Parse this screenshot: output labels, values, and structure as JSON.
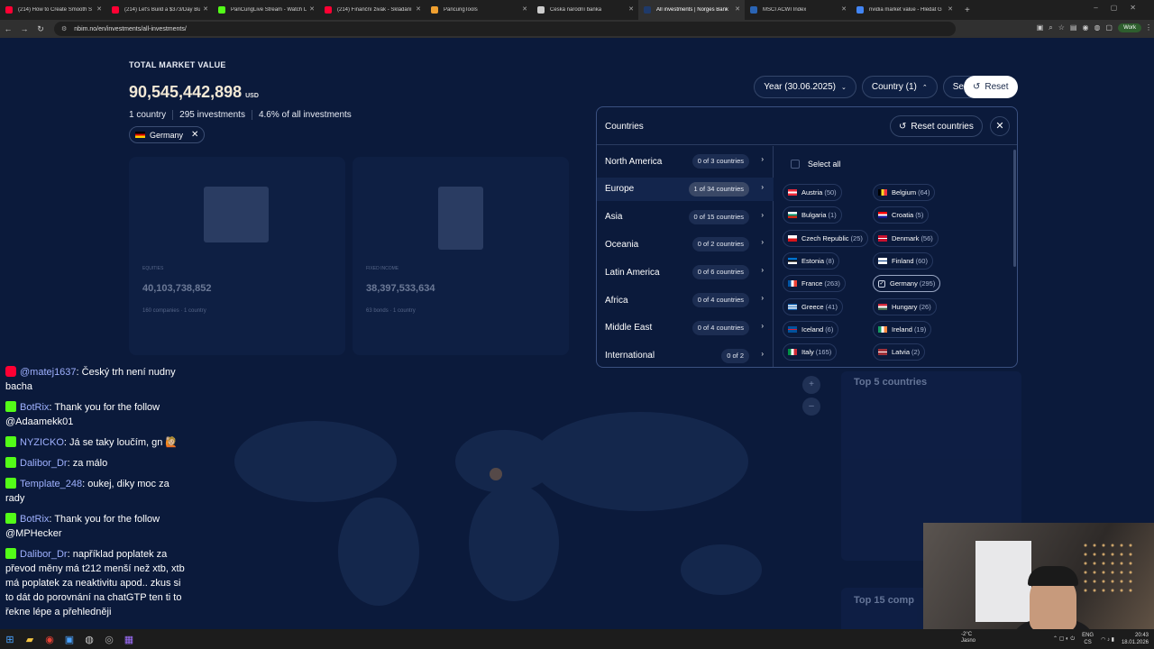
{
  "browser": {
    "tabs": [
      {
        "label": "(214) How to Create Smooth S",
        "icon_color": "#ff0033"
      },
      {
        "label": "(214) Let's Build a $373/Day Bu",
        "icon_color": "#ff0033"
      },
      {
        "label": "PanCungLive Stream - Watch Li",
        "icon_color": "#53fc18"
      },
      {
        "label": "(214) Finanční živák - Skládání",
        "icon_color": "#ff0033"
      },
      {
        "label": "PancungTools",
        "icon_color": "#f0a030"
      },
      {
        "label": "Česká národní banka",
        "icon_color": "#cccccc"
      },
      {
        "label": "All investments | Norges Bank",
        "icon_color": "#1f3a6a"
      },
      {
        "label": "MSCI ACWI Index",
        "icon_color": "#2a64b4"
      },
      {
        "label": "nvidia market value - Hledat G",
        "icon_color": "#4285f4"
      }
    ],
    "url": "nbim.no/en/investments/all-investments/",
    "profile_badge": "Work"
  },
  "summary": {
    "label": "TOTAL MARKET VALUE",
    "value": "90,545,442,898",
    "currency": "USD",
    "countries": "1 country",
    "investments": "295 investments",
    "share": "4.6% of all investments",
    "filter_chip": "Germany"
  },
  "filters": {
    "year": "Year (30.06.2025)",
    "country": "Country (1)",
    "sector": "Sector (all)",
    "reset": "Reset"
  },
  "countries_panel": {
    "title": "Countries",
    "reset": "Reset countries",
    "select_all": "Select all",
    "regions": [
      {
        "name": "North America",
        "count": "0 of 3 countries"
      },
      {
        "name": "Europe",
        "count": "1 of 34 countries",
        "active": true
      },
      {
        "name": "Asia",
        "count": "0 of 15 countries"
      },
      {
        "name": "Oceania",
        "count": "0 of 2 countries"
      },
      {
        "name": "Latin America",
        "count": "0 of 6 countries"
      },
      {
        "name": "Africa",
        "count": "0 of 4 countries"
      },
      {
        "name": "Middle East",
        "count": "0 of 4 countries"
      },
      {
        "name": "International",
        "count": "0 of 2"
      }
    ],
    "countries": [
      {
        "name": "Austria",
        "n": "(50)"
      },
      {
        "name": "Belgium",
        "n": "(64)"
      },
      {
        "name": "Bulgaria",
        "n": "(1)"
      },
      {
        "name": "Croatia",
        "n": "(5)"
      },
      {
        "name": "Czech Republic",
        "n": "(25)"
      },
      {
        "name": "Denmark",
        "n": "(56)"
      },
      {
        "name": "Estonia",
        "n": "(8)"
      },
      {
        "name": "Finland",
        "n": "(60)"
      },
      {
        "name": "France",
        "n": "(263)"
      },
      {
        "name": "Germany",
        "n": "(295)",
        "selected": true
      },
      {
        "name": "Greece",
        "n": "(41)"
      },
      {
        "name": "Hungary",
        "n": "(26)"
      },
      {
        "name": "Iceland",
        "n": "(6)"
      },
      {
        "name": "Ireland",
        "n": "(19)"
      },
      {
        "name": "Italy",
        "n": "(165)"
      },
      {
        "name": "Latvia",
        "n": "(2)"
      }
    ]
  },
  "background": {
    "card1": {
      "label": "EQUITIES",
      "value": "40,103,738,852",
      "sub": "160 companies · 1 country"
    },
    "card2": {
      "label": "FIXED INCOME",
      "value": "38,397,533,634",
      "sub": "63 bonds · 1 country"
    },
    "top5": "Top 5 countries",
    "top15": "Top 15 comp"
  },
  "chat": [
    {
      "platform": "yt",
      "user": "@matej1637",
      "text": "Český trh není nudny bacha"
    },
    {
      "platform": "kick",
      "user": "BotRix",
      "text": "Thank you for the follow @Adaamekk01"
    },
    {
      "platform": "kick",
      "user": "NYZICKO",
      "text": "Já se taky loučím, gn 🙋🏼"
    },
    {
      "platform": "kick",
      "user": "Dalibor_Dr",
      "text": "za málo"
    },
    {
      "platform": "kick",
      "user": "Template_248",
      "text": "oukej, diky moc za rady"
    },
    {
      "platform": "kick",
      "user": "BotRix",
      "text": "Thank you for the follow @MPHecker"
    },
    {
      "platform": "kick",
      "user": "Dalibor_Dr",
      "text": "například poplatek za převod měny má t212 menší než xtb, xtb má poplatek za neaktivitu apod.. zkus si to dát do porovnání na chatGTP ten ti to řekne lépe a přehledněji"
    }
  ],
  "taskbar": {
    "weather_temp": "-2°C",
    "weather_text": "Jasno",
    "lang": "ENG",
    "lang2": "CS",
    "time": "20:43",
    "date": "18.01.2026"
  }
}
